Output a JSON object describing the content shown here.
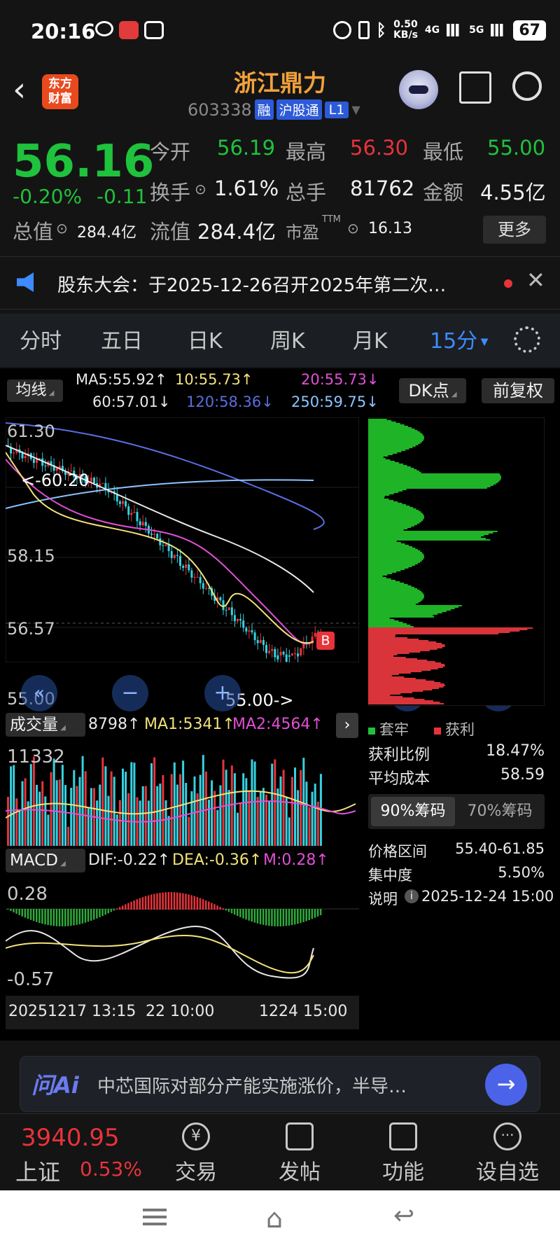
{
  "status_bar": {
    "time": "20:16",
    "net_speed_top": "0.50",
    "net_speed_unit": "KB/s",
    "sig1": "4G",
    "sig2": "5G",
    "battery": "67"
  },
  "header": {
    "back_label": "‹",
    "logo_line1": "东方",
    "logo_line2": "财富",
    "title": "浙江鼎力",
    "code": "603338",
    "tag_margin": "融",
    "tag_connect": "沪股通",
    "tag_level": "L1"
  },
  "quote": {
    "price": "56.16",
    "change_pct": "-0.20%",
    "change": "-0.11",
    "open_label": "今开",
    "open": "56.19",
    "high_label": "最高",
    "high": "56.30",
    "low_label": "最低",
    "low": "55.00",
    "turnover_label": "换手",
    "turnover": "1.61%",
    "volume_label": "总手",
    "volume": "81762",
    "amount_label": "金额",
    "amount": "4.55亿",
    "total_value_label": "总值",
    "total_value": "284.4亿",
    "float_value_label": "流值",
    "float_value": "284.4亿",
    "pe_label": "市盈",
    "pe_sup": "TTM",
    "pe": "16.13",
    "more": "更多"
  },
  "notice": {
    "text": "股东大会：于2025-12-26召开2025年第二次…"
  },
  "tabs": [
    "分时",
    "五日",
    "日K",
    "周K",
    "月K",
    "15分"
  ],
  "chart_controls": {
    "indicator": "均线",
    "dk_button": "DK点",
    "adjust_button": "前复权"
  },
  "ma_legend": [
    {
      "text": "MA5:55.92↑",
      "color": "#e8e8e8"
    },
    {
      "text": "10:55.73↑",
      "color": "#f2e27a"
    },
    {
      "text": "20:55.73↓",
      "color": "#e24fd6"
    },
    {
      "text": "60:57.01↓",
      "color": "#e8e8e8"
    },
    {
      "text": "120:58.36↓",
      "color": "#5a6ee0"
    },
    {
      "text": "250:59.75↓",
      "color": "#8cc4ff"
    }
  ],
  "price_axis": {
    "top": "61.30",
    "mid1": "58.15",
    "mid2": "56.57",
    "bottom": "55.00",
    "high_mark": "<-60.20",
    "low_mark": "55.00->",
    "b_marker": "B"
  },
  "volume_panel": {
    "label": "成交量",
    "value": "8798↑",
    "ma1": "MA1:5341↑",
    "ma2": "MA2:4564↑",
    "axis_top": "11332"
  },
  "macd_panel": {
    "label": "MACD",
    "dif": "DIF:-0.22↑",
    "dea": "DEA:-0.36↑",
    "m": "M:0.28↑",
    "axis_top": "0.28",
    "axis_bottom": "-0.57"
  },
  "time_axis": {
    "left": "20251217 13:15",
    "mid_left": "22 10:00",
    "mid_right": "1224 15:00"
  },
  "chip": {
    "legend_trapped": "套牢",
    "legend_profit": "获利",
    "profit_ratio_label": "获利比例",
    "profit_ratio": "18.47%",
    "avg_cost_label": "平均成本",
    "avg_cost": "58.59",
    "tab_90": "90%筹码",
    "tab_70": "70%筹码",
    "range_label": "价格区间",
    "range": "55.40-61.85",
    "concentration_label": "集中度",
    "concentration": "5.50%",
    "note_label": "说明",
    "note_time": "2025-12-24 15:00"
  },
  "ai_bar": {
    "brand": "问Ai",
    "text": "中芯国际对部分产能实施涨价，半导…"
  },
  "bottom": {
    "index_value": "3940.95",
    "index_name": "上证",
    "index_change": "0.53%",
    "nav": [
      "交易",
      "发帖",
      "功能",
      "设自选"
    ]
  },
  "colors": {
    "up": "#e8333a",
    "down": "#1fc23c",
    "accent": "#f2a13b",
    "blue": "#3d8bff"
  }
}
